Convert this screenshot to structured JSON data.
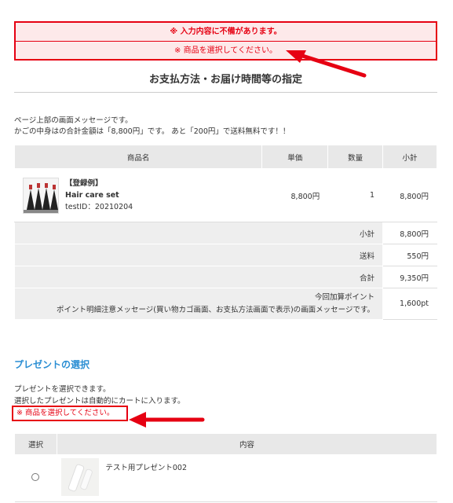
{
  "error_box": {
    "line1": "※ 入力内容に不備があります。",
    "line2": "※ 商品を選択してください。"
  },
  "page_title": "お支払方法・お届け時間等の指定",
  "message": {
    "line1": "ページ上部の画面メッセージです。",
    "line2": "かごの中身はの合計金額は「8,800円」です。 あと「200円」で送料無料です！！"
  },
  "cart_table": {
    "headers": [
      "商品名",
      "単価",
      "数量",
      "小計"
    ],
    "item": {
      "label": "【登録例】",
      "name": "Hair care set",
      "test_id": "testID：20210204",
      "unit_price": "8,800円",
      "quantity": "1",
      "subtotal": "8,800円"
    },
    "summary": [
      {
        "label": "小計",
        "value": "8,800円"
      },
      {
        "label": "送料",
        "value": "550円"
      },
      {
        "label": "合計",
        "value": "9,350円"
      }
    ],
    "points": {
      "label_line1": "今回加算ポイント",
      "label_line2": "ポイント明細注意メッセージ(買い物カゴ画面、お支払方法画面で表示)の画面メッセージです。",
      "value": "1,600pt"
    }
  },
  "present_section": {
    "title": "プレゼントの選択",
    "desc1": "プレゼントを選択できます。",
    "desc2": "選択したプレゼントは自動的にカートに入ります。",
    "error": "※ 商品を選択してください。",
    "headers": [
      "選択",
      "内容"
    ],
    "items": [
      {
        "name": "テスト用プレゼント002"
      }
    ]
  },
  "colors": {
    "error": "#e60012",
    "accent": "#2a8ed3"
  }
}
